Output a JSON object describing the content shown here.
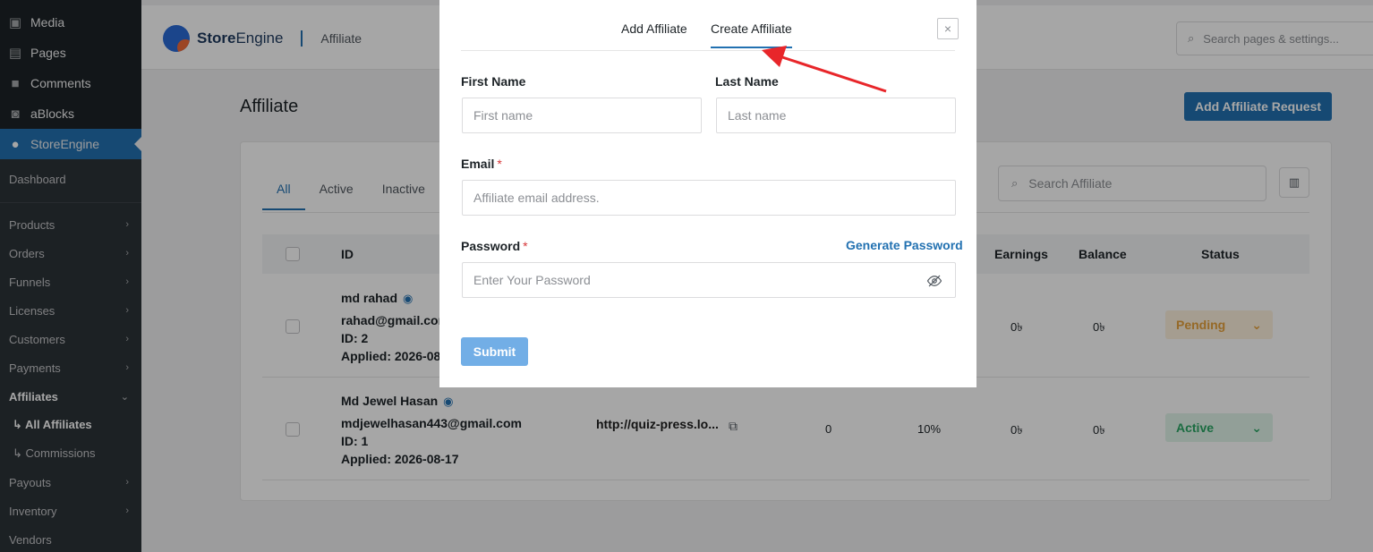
{
  "sidebar": {
    "wp_items": [
      {
        "label": "Media",
        "icon": "media-icon"
      },
      {
        "label": "Pages",
        "icon": "pages-icon"
      },
      {
        "label": "Comments",
        "icon": "comments-icon"
      },
      {
        "label": "aBlocks",
        "icon": "ablocks-icon"
      },
      {
        "label": "StoreEngine",
        "icon": "storeengine-icon"
      }
    ],
    "dashboard": "Dashboard",
    "items": [
      {
        "label": "Products"
      },
      {
        "label": "Orders"
      },
      {
        "label": "Funnels"
      },
      {
        "label": "Licenses"
      },
      {
        "label": "Customers"
      },
      {
        "label": "Payments"
      },
      {
        "label": "Affiliates"
      },
      {
        "label": "↳ All Affiliates"
      },
      {
        "label": "↳ Commissions"
      },
      {
        "label": "Payouts"
      },
      {
        "label": "Inventory"
      },
      {
        "label": "Vendors"
      }
    ]
  },
  "header": {
    "logo_bold": "Store",
    "logo_rest": "Engine",
    "breadcrumb": "Affiliate",
    "search_placeholder": "Search pages & settings..."
  },
  "page": {
    "title": "Affiliate",
    "add_button": "Add Affiliate Request",
    "tabs": [
      "All",
      "Active",
      "Inactive"
    ],
    "search_placeholder": "Search Affiliate",
    "columns": {
      "id": "ID",
      "earnings": "Earnings",
      "balance": "Balance",
      "status": "Status"
    },
    "rows": [
      {
        "name": "md rahad",
        "email": "rahad@gmail.com",
        "id": "ID: 2",
        "applied": "Applied: 2026-08",
        "earnings": "0৳",
        "balance": "0৳",
        "status": "Pending"
      },
      {
        "name": "Md Jewel Hasan",
        "email": "mdjewelhasan443@gmail.com",
        "id": "ID: 1",
        "applied": "Applied: 2026-08-17",
        "url": "http://quiz-press.lo...",
        "count": "0",
        "rate": "10%",
        "earnings": "0৳",
        "balance": "0৳",
        "status": "Active"
      }
    ]
  },
  "modal": {
    "tabs": [
      "Add Affiliate",
      "Create Affiliate"
    ],
    "close": "×",
    "first_name_label": "First Name",
    "first_name_placeholder": "First name",
    "last_name_label": "Last Name",
    "last_name_placeholder": "Last name",
    "email_label": "Email",
    "email_placeholder": "Affiliate email address.",
    "password_label": "Password",
    "password_placeholder": "Enter Your Password",
    "generate_password": "Generate Password",
    "required_mark": "*",
    "submit": "Submit"
  },
  "colors": {
    "accent": "#2271b1",
    "sidebar": "#1d2327",
    "annotation_arrow": "#e8262a"
  }
}
